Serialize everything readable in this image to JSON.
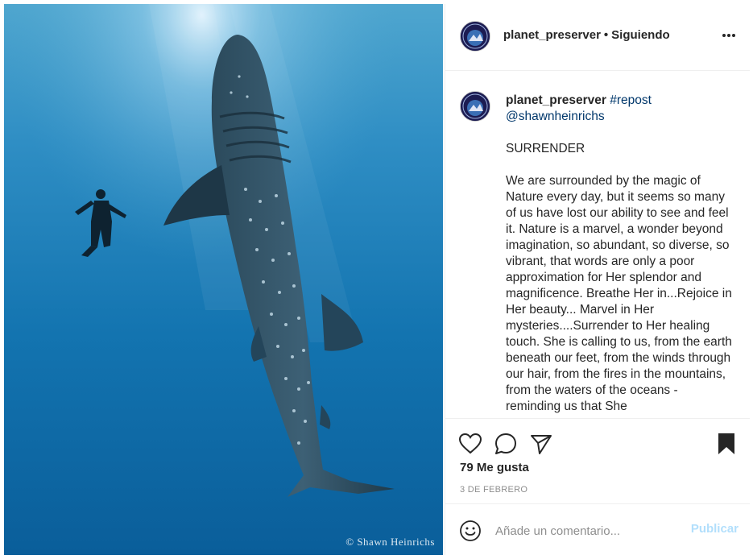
{
  "header": {
    "username": "planet_preserver",
    "separator": "•",
    "follow_status": "Siguiendo"
  },
  "photo": {
    "credit": "© Shawn Heinrichs"
  },
  "caption": {
    "username": "planet_preserver",
    "hashtag": "#repost",
    "mention": "@shawnheinrichs",
    "title": "SURRENDER",
    "body": "We are surrounded by the magic of Nature every day, but it seems so many of us have lost our ability to see and feel it. Nature is a marvel, a wonder beyond imagination, so abundant, so diverse, so vibrant, that words are only a poor approximation for Her splendor and magnificence. Breathe Her in...Rejoice in Her beauty... Marvel in Her mysteries....Surrender to Her healing touch. She is calling to us, from the earth beneath our feet, from the winds through our hair, from the fires in the mountains, from the waters of the oceans - reminding us that She"
  },
  "actions": {
    "likes": "79 Me gusta",
    "date": "3 DE FEBRERO",
    "icons": [
      "heart-icon",
      "comment-icon",
      "share-icon",
      "bookmark-icon"
    ]
  },
  "comment_box": {
    "placeholder": "Añade un comentario...",
    "post_label": "Publicar"
  },
  "colors": {
    "link": "#00376b",
    "post_button_disabled": "#b2dffc",
    "text": "#262626",
    "secondary_text": "#8e8e8e"
  }
}
